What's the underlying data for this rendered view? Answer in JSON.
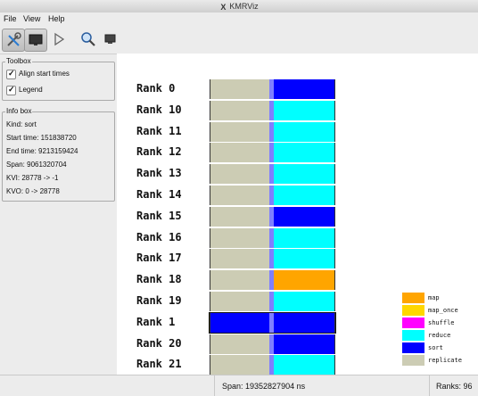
{
  "window": {
    "title": "KMRViz"
  },
  "menu": [
    "File",
    "View",
    "Help"
  ],
  "toolbar": {
    "buttons": [
      {
        "name": "settings-tools",
        "icon": "tools-icon",
        "active": true
      },
      {
        "name": "monitor",
        "icon": "monitor-icon",
        "active": true
      },
      {
        "name": "play",
        "icon": "play-icon",
        "active": false
      },
      {
        "name": "zoom",
        "icon": "magnifier-icon",
        "active": false
      },
      {
        "name": "screen",
        "icon": "screen-icon",
        "active": false
      }
    ]
  },
  "toolbox": {
    "title": "Toolbox",
    "align_label": "Align start times",
    "align_checked": true,
    "legend_label": "Legend",
    "legend_checked": true
  },
  "infobox": {
    "title": "Info box",
    "lines": [
      "Kind: sort",
      "Start time: 151838720",
      "End time: 9213159424",
      "Span: 9061320704",
      "KVI: 28778 -> -1",
      "KVO: 0 -> 28778"
    ]
  },
  "colors": {
    "map": "#ffa500",
    "map_once": "#ffd700",
    "shuffle": "#ff00ff",
    "reduce": "#00ffff",
    "sort": "#0000ff",
    "replicate": "#ccccb4",
    "border": "#333333",
    "aggregate": "#7f7fff"
  },
  "chart_data": {
    "type": "gantt",
    "legend": [
      {
        "name": "map",
        "color": "#ffa500"
      },
      {
        "name": "map_once",
        "color": "#ffd700"
      },
      {
        "name": "shuffle",
        "color": "#ff00ff"
      },
      {
        "name": "reduce",
        "color": "#00ffff"
      },
      {
        "name": "sort",
        "color": "#0000ff"
      },
      {
        "name": "replicate",
        "color": "#ccccb4"
      }
    ],
    "rows": [
      {
        "label": "Rank 0",
        "final": "sort"
      },
      {
        "label": "Rank 10",
        "final": "reduce"
      },
      {
        "label": "Rank 11",
        "final": "reduce"
      },
      {
        "label": "Rank 12",
        "final": "reduce"
      },
      {
        "label": "Rank 13",
        "final": "reduce"
      },
      {
        "label": "Rank 14",
        "final": "reduce"
      },
      {
        "label": "Rank 15",
        "final": "sort"
      },
      {
        "label": "Rank 16",
        "final": "reduce"
      },
      {
        "label": "Rank 17",
        "final": "reduce"
      },
      {
        "label": "Rank 18",
        "final": "map"
      },
      {
        "label": "Rank 19",
        "final": "reduce"
      },
      {
        "label": "Rank 1",
        "final": "sort",
        "selected": true
      },
      {
        "label": "Rank 20",
        "final": "sort"
      },
      {
        "label": "Rank 21",
        "final": "reduce"
      }
    ]
  },
  "status": {
    "span": "Span: 19352827904 ns",
    "ranks": "Ranks: 96"
  }
}
